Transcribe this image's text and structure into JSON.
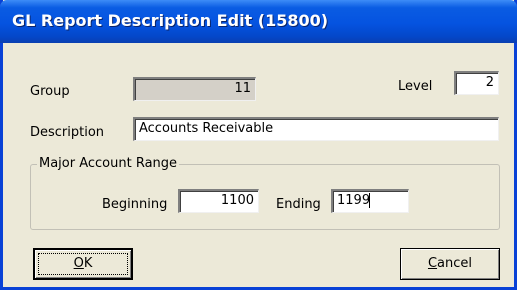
{
  "window": {
    "title": "GL Report Description Edit (15800)"
  },
  "form": {
    "group_label": "Group",
    "group_value": "11",
    "level_label": "Level",
    "level_value": "2",
    "description_label": "Description",
    "description_value": "Accounts Receivable"
  },
  "range": {
    "legend": "Major Account Range",
    "beginning_label": "Beginning",
    "beginning_value": "1100",
    "ending_label": "Ending",
    "ending_value": "1199"
  },
  "buttons": {
    "ok_mnemonic": "O",
    "ok_rest": "K",
    "cancel_mnemonic": "C",
    "cancel_rest": "ancel"
  }
}
